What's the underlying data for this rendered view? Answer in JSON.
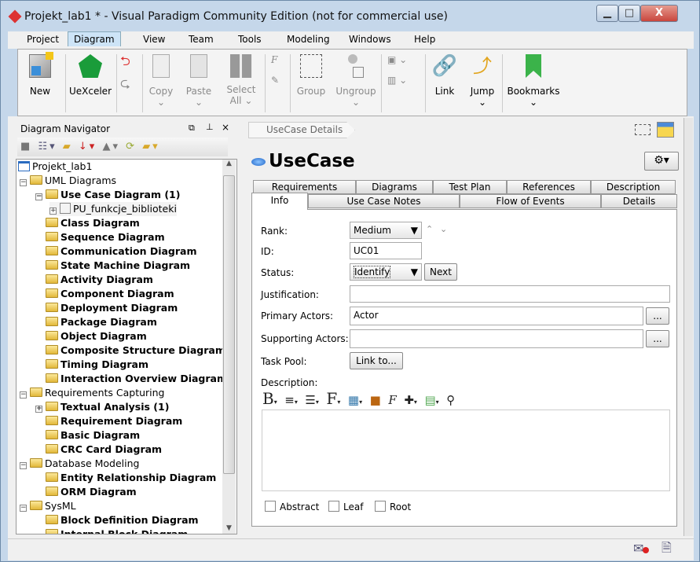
{
  "window": {
    "title": "Projekt_lab1 * - Visual Paradigm Community Edition (not for commercial use)",
    "minimize": "▁",
    "maximize": "□",
    "close": "X"
  },
  "menu": [
    "Project",
    "Diagram",
    "View",
    "Team",
    "Tools",
    "Modeling",
    "Windows",
    "Help"
  ],
  "menu_active": "Diagram",
  "ribbon": {
    "new": "New",
    "uexceler": "UeXceler",
    "copy": "Copy",
    "paste": "Paste",
    "select": "Select",
    "all": "All",
    "group": "Group",
    "ungroup": "Ungroup",
    "link": "Link",
    "jump": "Jump",
    "bookmarks": "Bookmarks",
    "chev": "⌄"
  },
  "navigator": {
    "title": "Diagram Navigator",
    "tree": [
      {
        "label": "Projekt_lab1",
        "level": 0,
        "icon": "project",
        "bold": false
      },
      {
        "label": "UML Diagrams",
        "level": 1,
        "icon": "folder",
        "bold": false,
        "exp": "−"
      },
      {
        "label": "Use Case Diagram (1)",
        "level": 2,
        "icon": "folder",
        "bold": true,
        "exp": "−"
      },
      {
        "label": "PU_funkcje_biblioteki",
        "level": 3,
        "icon": "diagram",
        "bold": false,
        "exp": "+"
      },
      {
        "label": "Class Diagram",
        "level": 2,
        "icon": "folder",
        "bold": true
      },
      {
        "label": "Sequence Diagram",
        "level": 2,
        "icon": "folder",
        "bold": true
      },
      {
        "label": "Communication Diagram",
        "level": 2,
        "icon": "folder",
        "bold": true
      },
      {
        "label": "State Machine Diagram",
        "level": 2,
        "icon": "folder",
        "bold": true
      },
      {
        "label": "Activity Diagram",
        "level": 2,
        "icon": "folder",
        "bold": true
      },
      {
        "label": "Component Diagram",
        "level": 2,
        "icon": "folder",
        "bold": true
      },
      {
        "label": "Deployment Diagram",
        "level": 2,
        "icon": "folder",
        "bold": true
      },
      {
        "label": "Package Diagram",
        "level": 2,
        "icon": "folder",
        "bold": true
      },
      {
        "label": "Object Diagram",
        "level": 2,
        "icon": "folder",
        "bold": true
      },
      {
        "label": "Composite Structure Diagram",
        "level": 2,
        "icon": "folder",
        "bold": true
      },
      {
        "label": "Timing Diagram",
        "level": 2,
        "icon": "folder",
        "bold": true
      },
      {
        "label": "Interaction Overview Diagram",
        "level": 2,
        "icon": "folder",
        "bold": true
      },
      {
        "label": "Requirements Capturing",
        "level": 1,
        "icon": "folder",
        "bold": false,
        "exp": "−"
      },
      {
        "label": "Textual Analysis (1)",
        "level": 2,
        "icon": "folder",
        "bold": true,
        "exp": "+"
      },
      {
        "label": "Requirement Diagram",
        "level": 2,
        "icon": "folder",
        "bold": true
      },
      {
        "label": "Basic Diagram",
        "level": 2,
        "icon": "folder",
        "bold": true
      },
      {
        "label": "CRC Card Diagram",
        "level": 2,
        "icon": "folder",
        "bold": true
      },
      {
        "label": "Database Modeling",
        "level": 1,
        "icon": "folder",
        "bold": false,
        "exp": "−"
      },
      {
        "label": "Entity Relationship Diagram",
        "level": 2,
        "icon": "folder",
        "bold": true
      },
      {
        "label": "ORM Diagram",
        "level": 2,
        "icon": "folder",
        "bold": true
      },
      {
        "label": "SysML",
        "level": 1,
        "icon": "folder",
        "bold": false,
        "exp": "−"
      },
      {
        "label": "Block Definition Diagram",
        "level": 2,
        "icon": "folder",
        "bold": true
      },
      {
        "label": "Internal Block Diagram",
        "level": 2,
        "icon": "folder",
        "bold": true
      }
    ]
  },
  "details": {
    "breadcrumb": "UseCase Details",
    "heading": "UseCase",
    "tabs_top": [
      "Requirements",
      "Diagrams",
      "Test Plan",
      "References",
      "Description"
    ],
    "tabs_bottom": [
      "Info",
      "Use Case Notes",
      "Flow of Events",
      "Details"
    ],
    "active_tab": "Info",
    "rank_label": "Rank:",
    "rank": "Medium",
    "id_label": "ID:",
    "id": "UC01",
    "status_label": "Status:",
    "status": "Identify",
    "next": "Next",
    "justification_label": "Justification:",
    "justification": "",
    "primary_label": "Primary Actors:",
    "primary": "Actor",
    "supporting_label": "Supporting Actors:",
    "supporting": "",
    "taskpool_label": "Task Pool:",
    "link_to": "Link to...",
    "description_label": "Description:",
    "browse": "...",
    "abstract": "Abstract",
    "leaf": "Leaf",
    "root": "Root"
  },
  "colors": {
    "accent": "#cde4f7",
    "title_bg": "#c5d7ea",
    "close": "#c9463d"
  }
}
